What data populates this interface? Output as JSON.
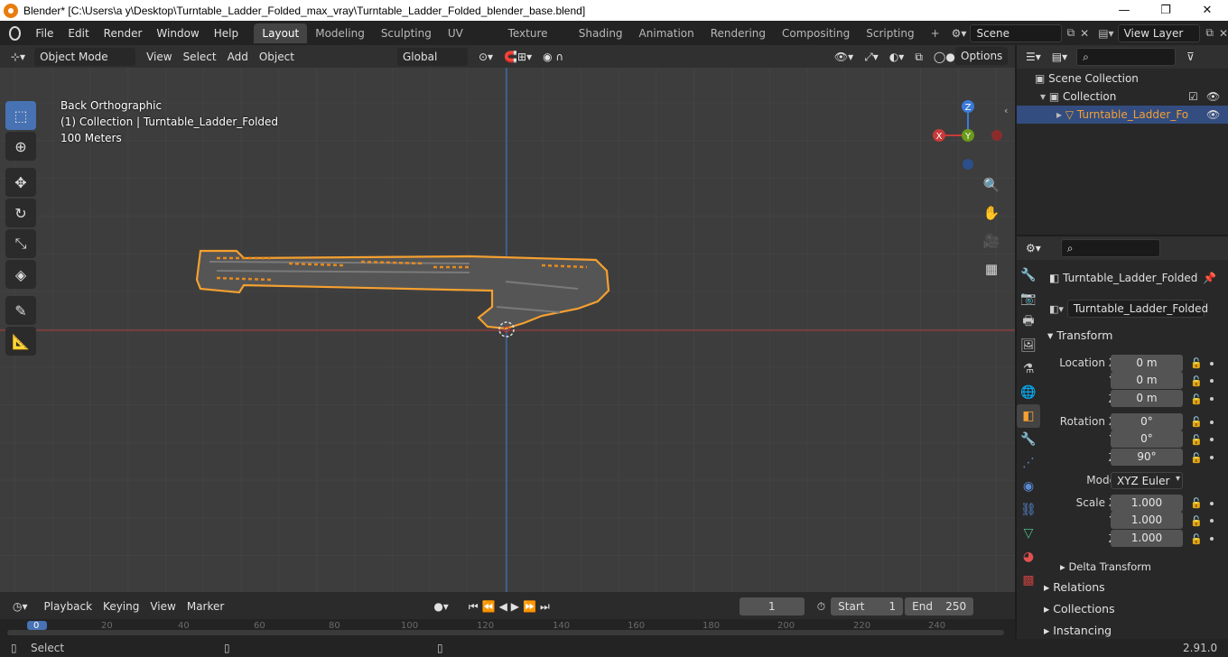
{
  "window": {
    "title": "Blender* [C:\\Users\\a y\\Desktop\\Turntable_Ladder_Folded_max_vray\\Turntable_Ladder_Folded_blender_base.blend]",
    "minimize": "—",
    "maximize": "❐",
    "close": "✕"
  },
  "menu": [
    "File",
    "Edit",
    "Render",
    "Window",
    "Help"
  ],
  "workspaces": [
    "Layout",
    "Modeling",
    "Sculpting",
    "UV Editing",
    "Texture Paint",
    "Shading",
    "Animation",
    "Rendering",
    "Compositing",
    "Scripting"
  ],
  "active_workspace": "Layout",
  "scene_name": "Scene",
  "view_layer": "View Layer",
  "viewport_header": {
    "mode": "Object Mode",
    "items": [
      "View",
      "Select",
      "Add",
      "Object"
    ],
    "orientation": "Global",
    "options": "Options"
  },
  "viewport_overlay": {
    "view_name": "Back Orthographic",
    "collection_info": "(1) Collection | Turntable_Ladder_Folded",
    "scale": "100 Meters"
  },
  "gizmo": {
    "z": "Z",
    "x": "X",
    "y": "Y"
  },
  "timeline": {
    "menus": [
      "Playback",
      "Keying",
      "View",
      "Marker"
    ],
    "current_frame": "1",
    "start_label": "Start",
    "start": "1",
    "end_label": "End",
    "end": "250",
    "ruler_ticks": [
      "0",
      "20",
      "40",
      "60",
      "80",
      "100",
      "120",
      "140",
      "160",
      "180",
      "200",
      "220",
      "240"
    ]
  },
  "status": {
    "left": "Select",
    "version": "2.91.0"
  },
  "outliner": {
    "scene_collection": "Scene Collection",
    "collection": "Collection",
    "object": "Turntable_Ladder_Fo"
  },
  "properties": {
    "object_name": "Turntable_Ladder_Folded",
    "data_name": "Turntable_Ladder_Folded",
    "transform_header": "Transform",
    "location_label": "Location X",
    "y_label": "Y",
    "z_label": "Z",
    "rotation_label": "Rotation X",
    "location": [
      "0 m",
      "0 m",
      "0 m"
    ],
    "rotation": [
      "0°",
      "0°",
      "90°"
    ],
    "mode_label": "Mode",
    "mode_value": "XYZ Euler",
    "scale_label": "Scale X",
    "scale": [
      "1.000",
      "1.000",
      "1.000"
    ],
    "delta_transform": "Delta Transform",
    "relations": "Relations",
    "collections": "Collections",
    "instancing": "Instancing"
  },
  "colors": {
    "selection_outline": "#f5a030",
    "x_axis": "#c83a3a",
    "y_axis": "#5a9a1a",
    "z_axis": "#3a7ad8",
    "active_blue": "#4772b3"
  }
}
